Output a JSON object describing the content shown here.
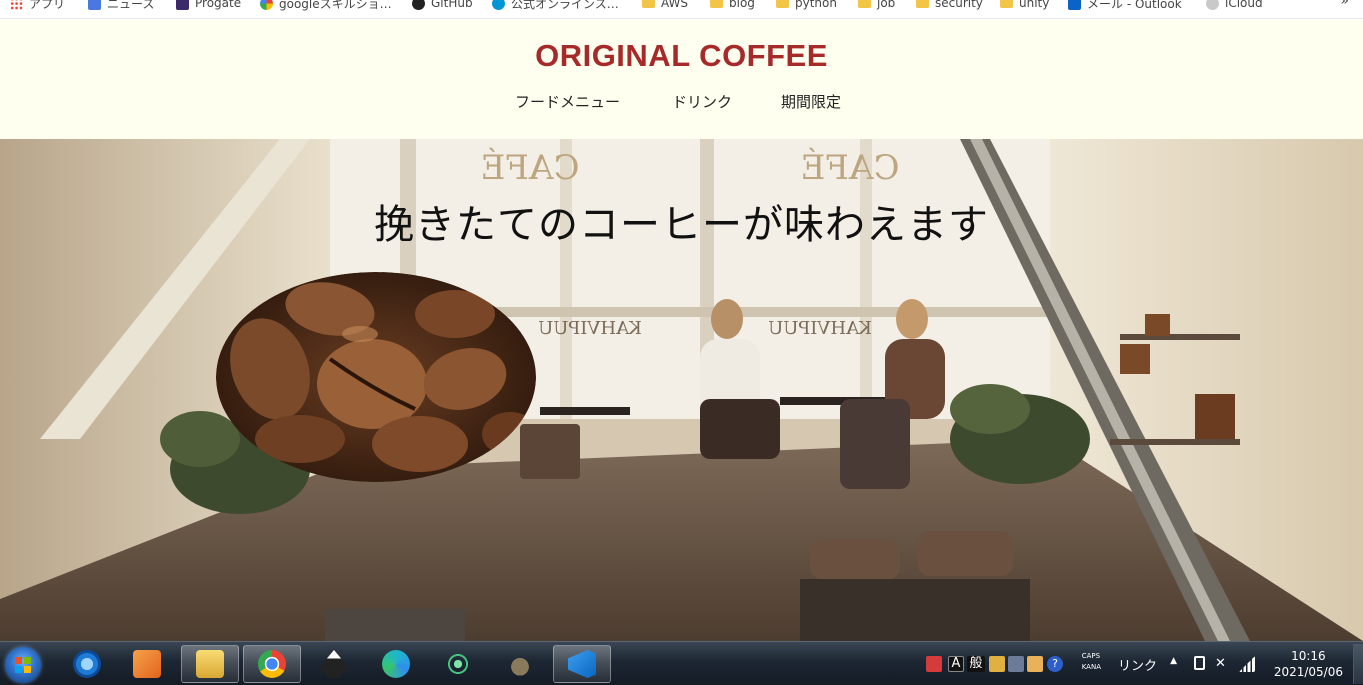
{
  "bookmarks": {
    "items": [
      {
        "label": "アプリ",
        "icon": "apps-grid-icon"
      },
      {
        "label": "ニュース",
        "icon": "google-news-icon"
      },
      {
        "label": "Progate",
        "icon": "progate-icon"
      },
      {
        "label": "googleスキルショ…",
        "icon": "google-icon"
      },
      {
        "label": "GitHub",
        "icon": "github-icon"
      },
      {
        "label": "公式オンラインス…",
        "icon": "hp-icon"
      },
      {
        "label": "AWS",
        "icon": "folder-icon"
      },
      {
        "label": "blog",
        "icon": "folder-icon"
      },
      {
        "label": "python",
        "icon": "folder-icon"
      },
      {
        "label": "job",
        "icon": "folder-icon"
      },
      {
        "label": "security",
        "icon": "folder-icon"
      },
      {
        "label": "unity",
        "icon": "folder-icon"
      },
      {
        "label": "メール - Outlook",
        "icon": "outlook-icon"
      },
      {
        "label": "iCloud",
        "icon": "icloud-icon"
      }
    ],
    "more": "»"
  },
  "site": {
    "title": "ORIGINAL COFFEE",
    "nav": [
      "フードメニュー",
      "ドリンク",
      "期間限定"
    ]
  },
  "hero": {
    "heading": "挽きたてのコーヒーが味わえます",
    "sign_cafe": "CAFÉ",
    "sign_kahvipuu": "KAHVIPUU"
  },
  "taskbar": {
    "apps": [
      {
        "name": "internet-explorer",
        "active": false
      },
      {
        "name": "media-player",
        "active": false
      },
      {
        "name": "file-explorer",
        "active": true
      },
      {
        "name": "chrome",
        "active": true
      },
      {
        "name": "inkscape",
        "active": false
      },
      {
        "name": "edge",
        "active": false
      },
      {
        "name": "atom",
        "active": false
      },
      {
        "name": "gimp",
        "active": false
      },
      {
        "name": "vscode",
        "active": true
      }
    ],
    "ime_mode": "A",
    "ime_kanji": "般",
    "caps": "CAPS",
    "kana": "KANA",
    "link_label": "リンク",
    "time": "10:16",
    "date": "2021/05/06"
  },
  "colors": {
    "title": "#a62a2a",
    "header_bg": "#fffff0"
  }
}
